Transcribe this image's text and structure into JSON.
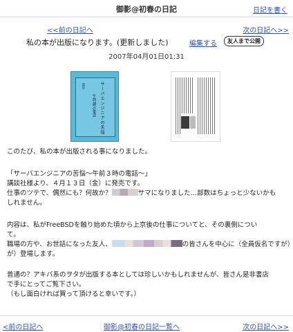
{
  "header": {
    "diary_title": "御影@初春の日記",
    "write_link": "日記を書く"
  },
  "nav": {
    "prev": "<<前の日記へ",
    "next": "次の日記へ>>"
  },
  "entry": {
    "title": "私の本が出版になります。(更新しました)",
    "edit_link": "編集する",
    "visibility_badge": "友人まで公開",
    "date": "2007年04月01日01:31",
    "book_cover_text": {
      "vertical_title": "サーバエンジニアの苦悩",
      "vertical_subtitle": "午前3時の電話",
      "author": "御影"
    },
    "paragraphs": [
      {
        "lines": [
          "このたび、私の本が出版される事になりました。"
        ]
      },
      {
        "lines": [
          "「サーバエンジニアの苦悩〜午前３時の電話〜」",
          "講談社様より、４月１３日（金）に発売です。"
        ],
        "mixed_line": {
          "before": "仕事のツテで、偶然にも？何故か？",
          "after": "サマになりました…部数はちょっと少ないかも"
        },
        "after_lines": [
          "しれません。"
        ]
      },
      {
        "lines": [
          "内容は、私がFreeBSDを触り始めた頃から上京後の仕事についてと、その裏側につい",
          "て。"
        ],
        "mixed_line": {
          "before": "職場の方や、お世話になった友人、",
          "after": "の皆さんを中心に（全員仮名ですが）"
        },
        "after_lines": [
          "が）登場します。"
        ]
      },
      {
        "lines": [
          "普通の？アキバ系のヲタが出版する本としては珍しいかもしれませんが、皆さん是非書店",
          "で手にとってご覧下さい。",
          "（もし面白ければ買って頂けると幸いです。）"
        ]
      }
    ]
  },
  "footer": {
    "prev": "<前の日記へ",
    "list": "御影@初春の日記一覧へ",
    "next": "次の日記へ>>"
  }
}
